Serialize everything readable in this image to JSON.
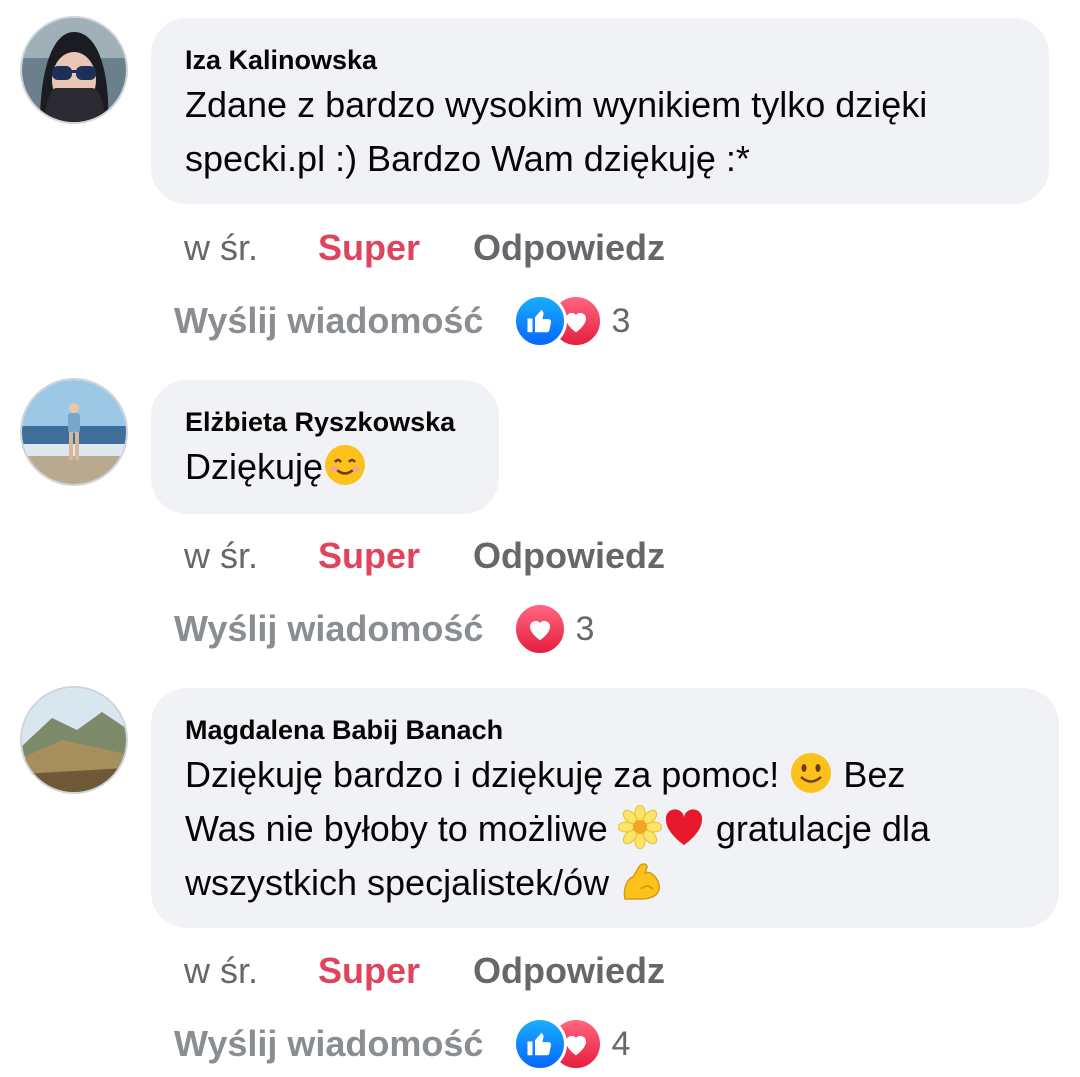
{
  "comments": [
    {
      "author": "Iza Kalinowska",
      "lines": [
        "Zdane z bardzo wysokim wynikiem tylko dzięki",
        "specki.pl  :) Bardzo Wam dziękuję  :*"
      ],
      "time": "w śr.",
      "like_label": "Super",
      "reply_label": "Odpowiedz",
      "send_label": "Wyślij wiadomość",
      "reactions": [
        "like-icon",
        "love-icon"
      ],
      "reaction_count": "3"
    },
    {
      "author": "Elżbieta Ryszkowska",
      "text": "Dziękuję",
      "time": "w śr.",
      "like_label": "Super",
      "reply_label": "Odpowiedz",
      "send_label": "Wyślij wiadomość",
      "reactions": [
        "love-icon"
      ],
      "reaction_count": "3"
    },
    {
      "author": "Magdalena Babij Banach",
      "line1_a": "Dziękuję bardzo i dziękuję za pomoc! ",
      "line1_b": " Bez",
      "line2_a": "Was nie byłoby to możliwe ",
      "line2_b": " gratulacje dla",
      "line3_a": "wszystkich specjalistek/ów ",
      "time": "w śr.",
      "like_label": "Super",
      "reply_label": "Odpowiedz",
      "send_label": "Wyślij wiadomość",
      "reactions": [
        "like-icon",
        "love-icon"
      ],
      "reaction_count": "4"
    }
  ],
  "colors": {
    "bubble": "#f0f2f5",
    "super": "#e0435c",
    "secondary": "#65676b",
    "like": "#0866ff",
    "love": "#e61e3f"
  }
}
